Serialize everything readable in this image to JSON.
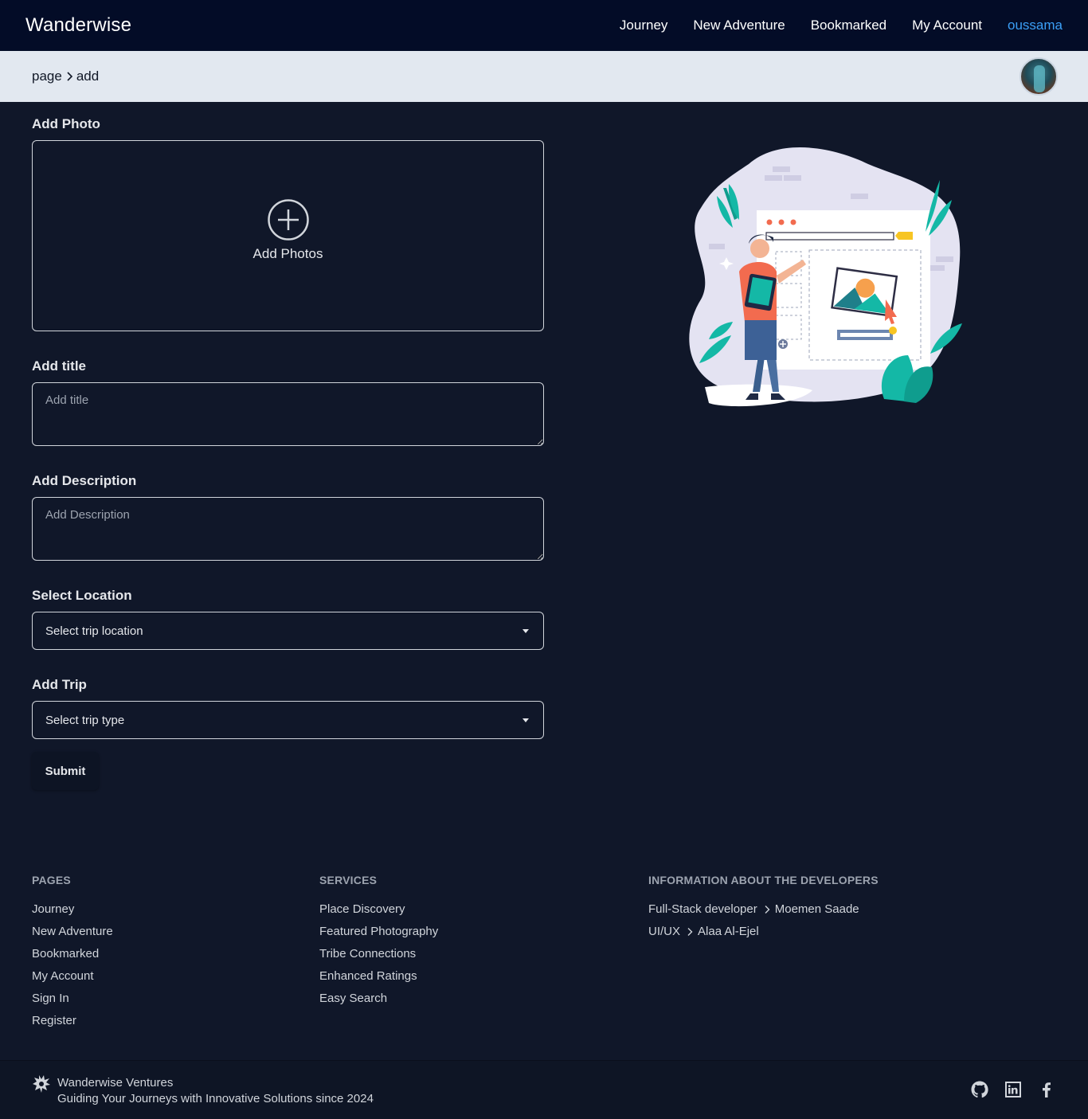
{
  "nav": {
    "brand": "Wanderwise",
    "links": [
      "Journey",
      "New Adventure",
      "Bookmarked",
      "My Account"
    ],
    "user": "oussama"
  },
  "breadcrumb": {
    "parent": "page",
    "current": "add"
  },
  "form": {
    "photo_label": "Add Photo",
    "photo_caption": "Add Photos",
    "title_label": "Add title",
    "title_placeholder": "Add title",
    "description_label": "Add Description",
    "description_placeholder": "Add Description",
    "location_label": "Select Location",
    "location_value": "Select trip location",
    "trip_label": "Add Trip",
    "trip_value": "Select trip type",
    "submit": "Submit"
  },
  "footer": {
    "pages_heading": "PAGES",
    "pages": [
      "Journey",
      "New Adventure",
      "Bookmarked",
      "My Account",
      "Sign In",
      "Register"
    ],
    "services_heading": "SERVICES",
    "services": [
      "Place Discovery",
      "Featured Photography",
      "Tribe Connections",
      "Enhanced Ratings",
      "Easy Search"
    ],
    "dev_heading": "INFORMATION ABOUT THE DEVELOPERS",
    "dev_lines": [
      {
        "role": "Full-Stack developer",
        "name": "Moemen Saade"
      },
      {
        "role": "UI/UX",
        "name": "Alaa Al-Ejel"
      }
    ],
    "company": "Wanderwise Ventures",
    "tagline": "Guiding Your Journeys with Innovative Solutions since 2024",
    "social_icons": [
      "github-icon",
      "linkedin-icon",
      "facebook-icon"
    ]
  },
  "colors": {
    "background": "#101729",
    "navbar": "#030c27",
    "breadcrumb_bar": "#e2e8f0",
    "accent_user": "#3b9ff6",
    "illustration_teal": "#14b8a6",
    "illustration_orange": "#f26b4f"
  }
}
